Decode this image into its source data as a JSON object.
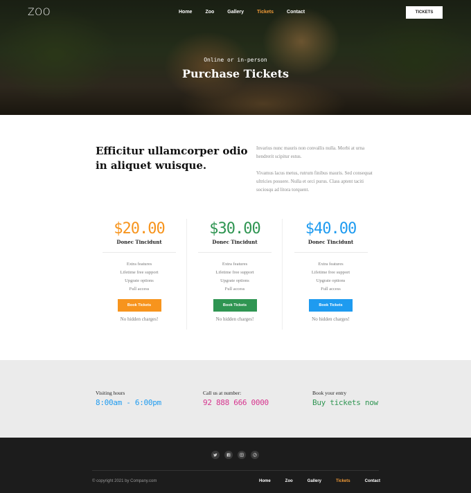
{
  "brand": {
    "logo": "ZOO"
  },
  "nav": {
    "items": [
      {
        "label": "Home",
        "active": false
      },
      {
        "label": "Zoo",
        "active": false
      },
      {
        "label": "Gallery",
        "active": false
      },
      {
        "label": "Tickets",
        "active": true
      },
      {
        "label": "Contact",
        "active": false
      }
    ],
    "cta_label": "TICKETS"
  },
  "hero": {
    "subtitle": "Online or in-person",
    "title": "Purchase Tickets"
  },
  "intro": {
    "heading": "Efficitur ullamcorper odio in aliquet wuisque.",
    "paragraph1": "Invarius nunc mauris non convallis nulla. Morbi at urna hendrerit scipitur estus.",
    "paragraph2": "Vivamus lacus metus, rutrum finibus mauris. Sed consequat ultricies posuere. Nulla et orci purus. Class aptent taciti sociosqu ad litora torquent."
  },
  "pricing": [
    {
      "price": "$20.00",
      "plan": "Donec Tincidunt",
      "color": "#f7941d",
      "features": [
        "Extra features",
        "Lifetime free support",
        "Upgrate options",
        "Full access"
      ],
      "button": "Book Tickets",
      "note": "No hidden charges!"
    },
    {
      "price": "$30.00",
      "plan": "Donec Tincidunt",
      "color": "#2f9552",
      "features": [
        "Extra features",
        "Lifetime free support",
        "Upgrate options",
        "Full access"
      ],
      "button": "Book Tickets",
      "note": "No hidden charges!"
    },
    {
      "price": "$40.00",
      "plan": "Donec Tincidunt",
      "color": "#1e9bf0",
      "features": [
        "Extra features",
        "Lifetime free support",
        "Upgrate options",
        "Full access"
      ],
      "button": "Book Tickets",
      "note": "No hidden charges!"
    }
  ],
  "info": [
    {
      "label": "Visiting hours",
      "value": "8:00am - 6:00pm",
      "color": "#1e9bf0"
    },
    {
      "label": "Call us at number:",
      "value": "92 888 666 0000",
      "color": "#d6348e"
    },
    {
      "label": "Book your entry",
      "value": "Buy tickets now",
      "color": "#2f9552"
    }
  ],
  "footer": {
    "social_icons": [
      "twitter-icon",
      "facebook-icon",
      "instagram-icon",
      "pinterest-icon"
    ],
    "copyright": "© copyright 2021 by Company.com",
    "nav": [
      {
        "label": "Home",
        "active": false
      },
      {
        "label": "Zoo",
        "active": false
      },
      {
        "label": "Gallery",
        "active": false
      },
      {
        "label": "Tickets",
        "active": true
      },
      {
        "label": "Contact",
        "active": false
      }
    ]
  },
  "colors": {
    "accent": "#f39c38",
    "footer_bg": "#1c1c1c",
    "band_bg": "#ebebeb"
  }
}
